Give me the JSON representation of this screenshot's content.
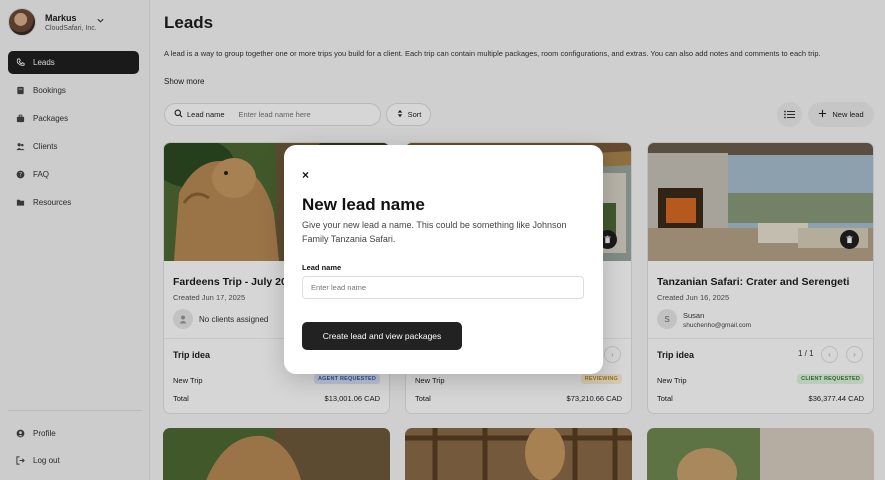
{
  "user": {
    "name": "Markus",
    "org": "CloudSafari, Inc."
  },
  "nav": [
    {
      "label": "Leads",
      "icon": "phone-icon",
      "active": true
    },
    {
      "label": "Bookings",
      "icon": "book-icon"
    },
    {
      "label": "Packages",
      "icon": "briefcase-icon"
    },
    {
      "label": "Clients",
      "icon": "users-icon"
    },
    {
      "label": "FAQ",
      "icon": "question-icon"
    },
    {
      "label": "Resources",
      "icon": "folder-icon"
    }
  ],
  "sidebar_bottom": [
    {
      "label": "Profile",
      "icon": "profile-icon"
    },
    {
      "label": "Log out",
      "icon": "logout-icon"
    }
  ],
  "page": {
    "title": "Leads",
    "description": "A lead is a way to group together one or more trips you build for a client. Each trip can contain multiple packages, room configurations, and extras. You can also add notes and comments to each trip.",
    "show_more": "Show more"
  },
  "toolbar": {
    "search_label": "Lead name",
    "search_placeholder": "Enter lead name here",
    "sort_label": "Sort",
    "new_lead_label": "New lead"
  },
  "cards": [
    {
      "title": "Fardeens Trip - July 2025",
      "created": "Created Jun 17, 2025",
      "client": "No clients assigned",
      "trip_label": "Trip idea",
      "trip_name": "New Trip",
      "status": "AGENT REQUESTED",
      "total_label": "Total",
      "total": "$13,001.06 CAD"
    },
    {
      "title": "",
      "created": "",
      "trip_label": "",
      "trip_name": "New Trip",
      "status": "REVIEWING",
      "total_label": "Total",
      "total": "$73,210.66 CAD"
    },
    {
      "title": "Tanzanian Safari: Crater and Serengeti",
      "created": "Created Jun 16, 2025",
      "client_initial": "S",
      "client_name": "Susan",
      "client_email": "shuchenho@gmail.com",
      "trip_label": "Trip idea",
      "pager": "1 / 1",
      "trip_name": "New Trip",
      "status": "CLIENT REQUESTED",
      "total_label": "Total",
      "total": "$36,377.44 CAD"
    }
  ],
  "modal": {
    "title": "New lead name",
    "description": "Give your new lead a name. This could be something like Johnson Family Tanzania Safari.",
    "field_label": "Lead name",
    "field_placeholder": "Enter lead name",
    "submit_label": "Create lead and view packages",
    "close_glyph": "×"
  },
  "colors": {
    "accent_dark": "#1f1f1f",
    "badge_agent_bg": "#dde6fb",
    "badge_agent_fg": "#3b5bb5",
    "badge_review_bg": "#fbefd6",
    "badge_review_fg": "#b8861a",
    "badge_client_bg": "#dff3df",
    "badge_client_fg": "#2f7d3a"
  }
}
